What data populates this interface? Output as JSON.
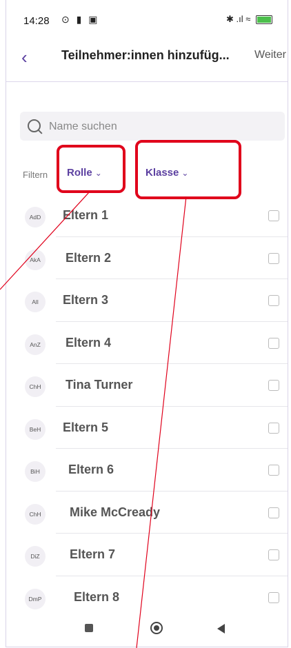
{
  "status_bar": {
    "time": "14:28",
    "left_icons": "⊙ ▮ ▣",
    "right_icons": "✱ .ıl ≈",
    "battery": "100"
  },
  "header": {
    "title": "Teilnehmer:innen hinzufüg...",
    "next_label": "Weiter",
    "back_icon": "chevron-left-icon"
  },
  "search": {
    "placeholder": "Name suchen",
    "value": ""
  },
  "filters": {
    "label": "Filtern",
    "role": "Rolle",
    "class": "Klasse",
    "chevron": "⌄"
  },
  "participants": [
    {
      "initials": "AdD",
      "name": "Eltern 1",
      "badge": false
    },
    {
      "initials": "AkA",
      "name": "Eltern 2",
      "badge": false
    },
    {
      "initials": "All",
      "name": "Eltern 3",
      "badge": false
    },
    {
      "initials": "AnZ",
      "name": "Eltern 4",
      "badge": false
    },
    {
      "initials": "ChH",
      "name": "Tina Turner",
      "badge": true
    },
    {
      "initials": "BeH",
      "name": "Eltern 5",
      "badge": false
    },
    {
      "initials": "BiH",
      "name": "Eltern 6",
      "badge": false
    },
    {
      "initials": "ChH",
      "name": "Mike McCready",
      "badge": true
    },
    {
      "initials": "DiZ",
      "name": "Eltern 7",
      "badge": false
    },
    {
      "initials": "DmP",
      "name": "Eltern 8",
      "badge": false
    }
  ],
  "colors": {
    "accent": "#5b3fa0",
    "highlight": "#e0001b",
    "annotation_line": "#e0001b"
  }
}
